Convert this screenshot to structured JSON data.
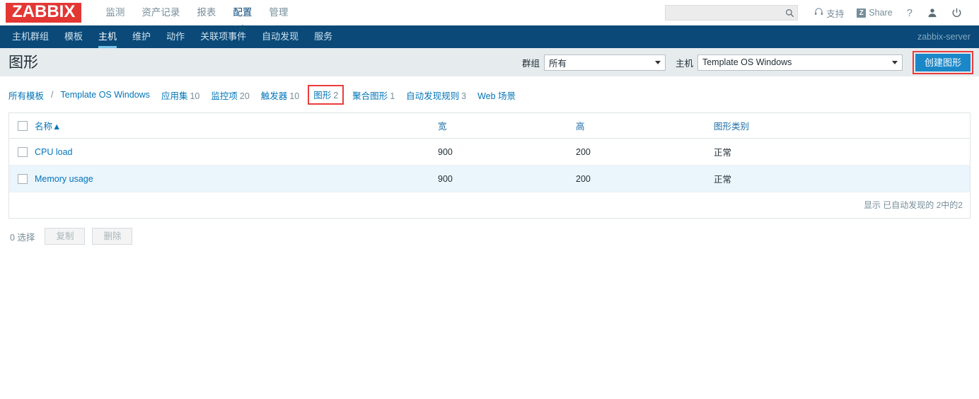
{
  "header": {
    "logo": "ZABBIX",
    "nav": [
      {
        "label": "监测",
        "active": false
      },
      {
        "label": "资产记录",
        "active": false
      },
      {
        "label": "报表",
        "active": false
      },
      {
        "label": "配置",
        "active": true
      },
      {
        "label": "管理",
        "active": false
      }
    ],
    "search": {
      "value": "",
      "placeholder": "",
      "icon": "search-icon"
    },
    "support_label": "支持",
    "support_icon": "headset-icon",
    "share_label": "Share",
    "share_badge": "Z",
    "help_label": "?",
    "user_icon": "user-icon",
    "logout_icon": "power-icon"
  },
  "subnav": {
    "items": [
      {
        "label": "主机群组",
        "active": false
      },
      {
        "label": "模板",
        "active": false
      },
      {
        "label": "主机",
        "active": true
      },
      {
        "label": "维护",
        "active": false
      },
      {
        "label": "动作",
        "active": false
      },
      {
        "label": "关联项事件",
        "active": false
      },
      {
        "label": "自动发现",
        "active": false
      },
      {
        "label": "服务",
        "active": false
      }
    ],
    "server": "zabbix-server"
  },
  "title_row": {
    "title": "图形",
    "group_label": "群组",
    "group_value": "所有",
    "host_label": "主机",
    "host_value": "Template OS Windows",
    "create_button": "创建图形"
  },
  "breadcrumb": {
    "all_templates": "所有模板",
    "separator": "/",
    "template_name": "Template OS Windows",
    "tabs": [
      {
        "label": "应用集",
        "count": "10",
        "highlight": false
      },
      {
        "label": "监控项",
        "count": "20",
        "highlight": false
      },
      {
        "label": "触发器",
        "count": "10",
        "highlight": false
      },
      {
        "label": "图形",
        "count": "2",
        "highlight": true
      },
      {
        "label": "聚合图形",
        "count": "1",
        "highlight": false
      },
      {
        "label": "自动发现规则",
        "count": "3",
        "highlight": false
      },
      {
        "label": "Web 场景",
        "count": "",
        "highlight": false
      }
    ]
  },
  "table": {
    "headers": {
      "name": "名称",
      "sort_arrow": "▲",
      "width": "宽",
      "height": "高",
      "type": "图形类别"
    },
    "rows": [
      {
        "name": "CPU load",
        "width": "900",
        "height": "200",
        "type": "正常"
      },
      {
        "name": "Memory usage",
        "width": "900",
        "height": "200",
        "type": "正常"
      }
    ],
    "footer": "显示 已自动发现的 2中的2"
  },
  "actions": {
    "selected_count": "0 选择",
    "copy_label": "复制",
    "delete_label": "删除"
  },
  "colors": {
    "logo_red": "#e33734",
    "nav_blue": "#0a4978",
    "link_blue": "#0275b8",
    "button_blue": "#1a87c8",
    "highlight_red": "#ec3b3b",
    "alt_row": "#ebf5fc"
  }
}
